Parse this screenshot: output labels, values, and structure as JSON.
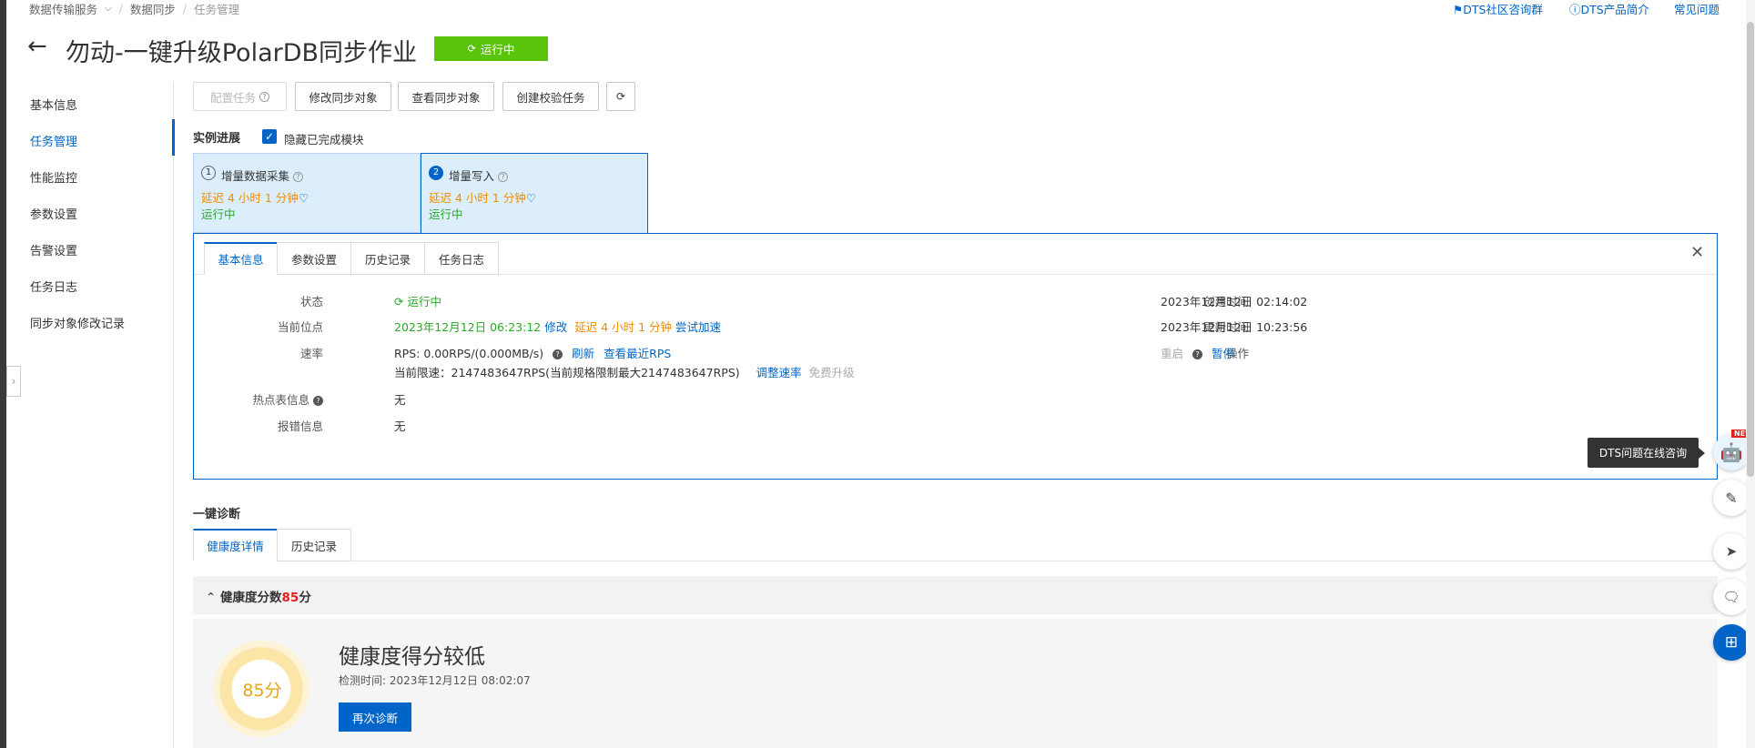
{
  "breadcrumb": {
    "items": [
      "数据传输服务",
      "数据同步",
      "任务管理"
    ]
  },
  "top_links": {
    "community": "DTS社区咨询群",
    "intro": "DTS产品简介",
    "faq": "常见问题"
  },
  "page": {
    "title": "勿动-一键升级PolarDB同步作业",
    "status": "运行中"
  },
  "sidebar": {
    "items": [
      "基本信息",
      "任务管理",
      "性能监控",
      "参数设置",
      "告警设置",
      "任务日志",
      "同步对象修改记录"
    ]
  },
  "toolbar": {
    "configure": "配置任务",
    "modify_objects": "修改同步对象",
    "view_objects": "查看同步对象",
    "create_check": "创建校验任务"
  },
  "progress": {
    "title": "实例进展",
    "hide_done": "隐藏已完成模块"
  },
  "steps": [
    {
      "num": "1",
      "name": "增量数据采集",
      "delay": "延迟 4 小时 1 分钟",
      "status": "运行中"
    },
    {
      "num": "2",
      "name": "增量写入",
      "delay": "延迟 4 小时 1 分钟",
      "status": "运行中"
    }
  ],
  "detail_tabs": [
    "基本信息",
    "参数设置",
    "历史记录",
    "任务日志"
  ],
  "detail": {
    "status_label": "状态",
    "status_value": "运行中",
    "position_label": "当前位点",
    "position_value": "2023年12月12日 06:23:12",
    "position_modify": "修改",
    "position_delay": "延迟 4 小时 1 分钟",
    "position_speedup": "尝试加速",
    "speed_label": "速率",
    "speed_value": "RPS: 0.00RPS/(0.000MB/s)",
    "speed_refresh": "刷新",
    "speed_recent": "查看最近RPS",
    "limit_value": "当前限速：2147483647RPS(当前规格限制最大2147483647RPS)",
    "limit_adjust": "调整速率",
    "limit_upgrade": "免费升级",
    "hot_label": "热点表信息",
    "hot_value": "无",
    "error_label": "报错信息",
    "error_value": "无",
    "created_label": "创建时间",
    "created_value": "2023年12月12日 02:14:02",
    "updated_label": "更新时间",
    "updated_value": "2023年12月12日 10:23:56",
    "op_label": "操作",
    "op_restart": "重启",
    "op_pause": "暂停"
  },
  "diagnosis": {
    "title": "一键诊断",
    "tabs": [
      "健康度详情",
      "历史记录"
    ],
    "score_header_prefix": "健康度分数",
    "score": "85",
    "score_unit": "分",
    "score_badge": "85分",
    "headline": "健康度得分较低",
    "check_time": "检测时间: 2023年12月12日 08:02:07",
    "rediagnose": "再次诊断"
  },
  "floating": {
    "tooltip": "DTS问题在线咨询",
    "new_badge": "NEW"
  }
}
